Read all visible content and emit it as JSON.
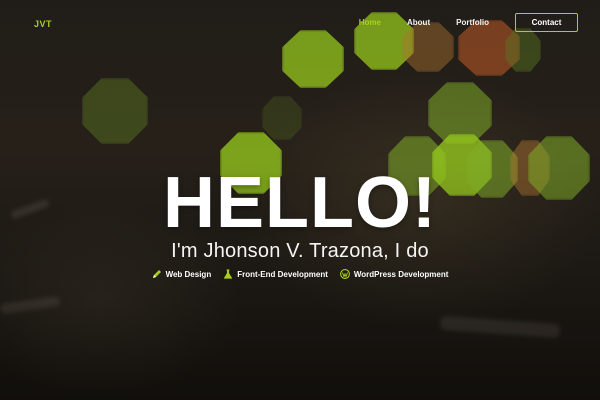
{
  "brand": {
    "logo": "JVT",
    "accent_color": "#a8cf1c"
  },
  "nav": {
    "items": [
      {
        "label": "Home",
        "active": true
      },
      {
        "label": "About",
        "active": false
      },
      {
        "label": "Portfolio",
        "active": false
      }
    ],
    "contact_label": "Contact"
  },
  "hero": {
    "headline": "HELLO!",
    "intro": "I'm Jhonson V. Trazona, I do",
    "skills": [
      {
        "label": "Web Design",
        "icon": "pen-icon"
      },
      {
        "label": "Front-End Development",
        "icon": "flask-icon"
      },
      {
        "label": "WordPress Development",
        "icon": "wordpress-icon"
      }
    ]
  }
}
